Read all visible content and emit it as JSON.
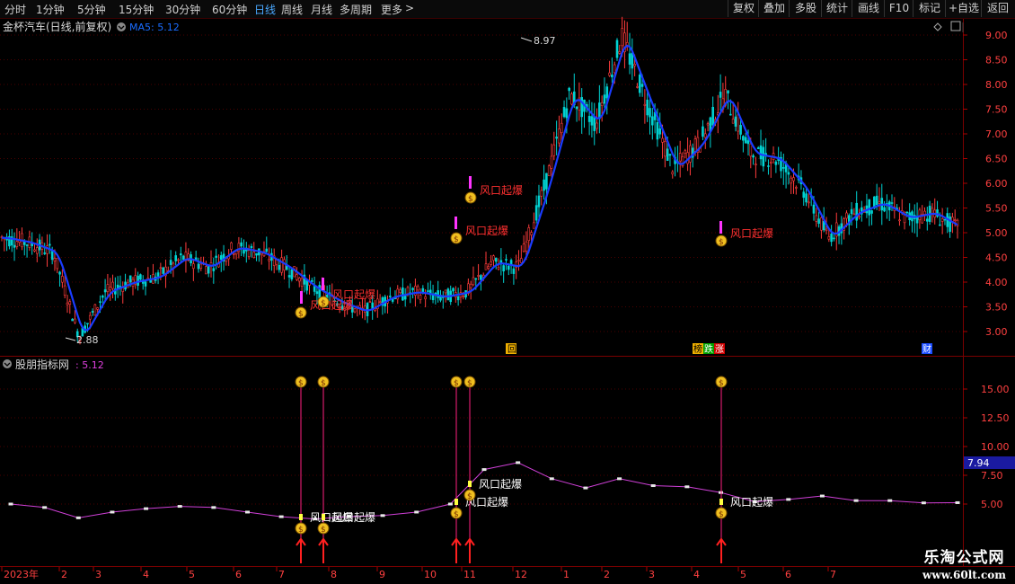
{
  "toolbar": {
    "timeframes": [
      "分时",
      "1分钟",
      "5分钟",
      "15分钟",
      "30分钟",
      "60分钟",
      "日线",
      "周线",
      "月线",
      "多周期",
      "更多"
    ],
    "active_index": 6,
    "more_arrow": ">",
    "right_buttons": [
      "复权",
      "叠加",
      "多股",
      "统计",
      "画线",
      "F10",
      "标记",
      "+自选",
      "返回"
    ]
  },
  "main_panel": {
    "stock_title": "金杯汽车(日线,前复权)",
    "ma_label": "MA5: 5.12",
    "y_ticks": [
      "9.00",
      "8.50",
      "8.00",
      "7.50",
      "7.00",
      "6.50",
      "6.00",
      "5.50",
      "5.00",
      "4.50",
      "4.00",
      "3.50",
      "3.00"
    ],
    "high_label": "8.97",
    "low_label": "2.88",
    "signal_text": "风口起爆",
    "markers": [
      "回",
      "榜",
      "跌",
      "涨",
      "财"
    ]
  },
  "indicator_panel": {
    "title": "股朋指标网",
    "value": ": 5.12",
    "y_ticks": [
      "15.00",
      "12.50",
      "10.00",
      "7.50",
      "5.00"
    ],
    "current_value": "7.94",
    "signal_text": "风口起爆"
  },
  "x_axis": {
    "labels": [
      "2023年",
      "2",
      "3",
      "4",
      "5",
      "6",
      "7",
      "8",
      "9",
      "10",
      "11",
      "12",
      "1",
      "2",
      "3",
      "4",
      "5",
      "6",
      "7"
    ]
  },
  "watermark": {
    "title": "乐淘公式网",
    "url": "www.60lt.com"
  },
  "colors": {
    "up": "#ff3c3c",
    "down": "#00d2d2",
    "ma": "#1a3cff",
    "signal": "#ff33ff",
    "indicator_line": "#e040e0",
    "grid": "#4a0000"
  },
  "chart_data": [
    {
      "type": "candlestick",
      "title": "金杯汽车(日线,前复权)",
      "ylim": [
        2.7,
        9.2
      ],
      "x_range": [
        "2023-01",
        "2024-07"
      ],
      "close_path": [
        [
          "2023-01",
          4.9
        ],
        [
          "2023-01-mid",
          4.8
        ],
        [
          "2023-02",
          4.6
        ],
        [
          "2023-02-low",
          2.88
        ],
        [
          "2023-02-end",
          3.8
        ],
        [
          "2023-03",
          4.0
        ],
        [
          "2023-03-mid",
          4.1
        ],
        [
          "2023-04",
          4.5
        ],
        [
          "2023-04-mid",
          4.3
        ],
        [
          "2023-05",
          4.7
        ],
        [
          "2023-05-mid",
          4.6
        ],
        [
          "2023-06",
          4.3
        ],
        [
          "2023-06-mid",
          3.9
        ],
        [
          "2023-07",
          3.6
        ],
        [
          "2023-07-mid",
          3.4
        ],
        [
          "2023-08",
          3.7
        ],
        [
          "2023-08-mid",
          3.8
        ],
        [
          "2023-09",
          3.7
        ],
        [
          "2023-09-mid",
          3.8
        ],
        [
          "2023-10",
          4.4
        ],
        [
          "2023-10-mid",
          4.3
        ],
        [
          "2023-11",
          5.9
        ],
        [
          "2023-11-mid",
          7.8
        ],
        [
          "2023-12",
          7.2
        ],
        [
          "2023-12-high",
          8.97
        ],
        [
          "2024-01",
          7.6
        ],
        [
          "2024-01-mid",
          6.3
        ],
        [
          "2024-02",
          6.8
        ],
        [
          "2024-02-mid",
          7.8
        ],
        [
          "2024-03",
          6.6
        ],
        [
          "2024-03-mid",
          6.5
        ],
        [
          "2024-04",
          5.9
        ],
        [
          "2024-04-mid",
          4.9
        ],
        [
          "2024-05",
          5.4
        ],
        [
          "2024-05-mid",
          5.6
        ],
        [
          "2024-06",
          5.3
        ],
        [
          "2024-06-mid",
          5.4
        ],
        [
          "2024-07",
          5.1
        ]
      ],
      "ma5": 5.12,
      "high": 8.97,
      "low": 2.88,
      "signals": [
        "风口起爆",
        "风口起爆",
        "风口起爆",
        "风口起爆",
        "风口起爆",
        "风口起爆"
      ]
    },
    {
      "type": "line",
      "title": "股朋指标网",
      "ylim": [
        0,
        18
      ],
      "values": [
        5.0,
        4.7,
        3.8,
        4.3,
        4.6,
        4.8,
        4.7,
        4.3,
        3.9,
        3.7,
        3.9,
        4.0,
        4.3,
        5.0,
        8.0,
        8.6,
        7.2,
        6.4,
        7.2,
        6.6,
        6.5,
        6.0,
        5.2,
        5.4,
        5.7,
        5.3,
        5.3,
        5.1,
        5.12
      ],
      "current": 7.94,
      "spike_value": 15.0
    }
  ]
}
